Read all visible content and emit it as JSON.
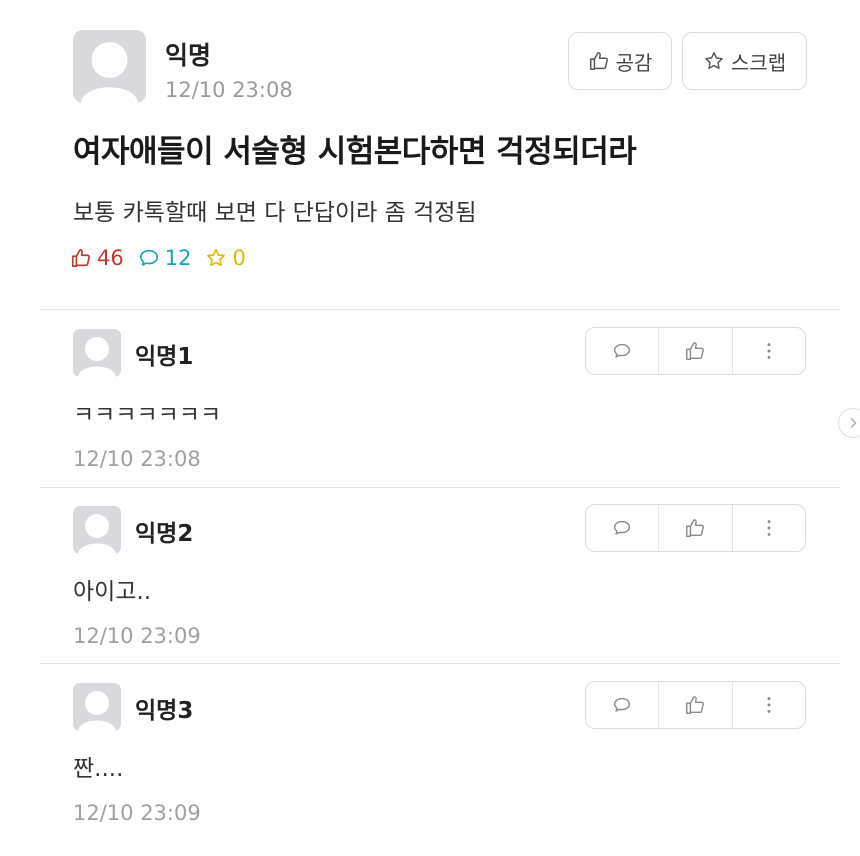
{
  "post": {
    "author": "익명",
    "time": "12/10 23:08",
    "title": "여자애들이 서술형 시험본다하면 걱정되더라",
    "body": "보통 카톡할때 보면 다 단답이라 좀 걱정됨",
    "buttons": {
      "like_label": "공감",
      "scrap_label": "스크랩"
    },
    "stats": {
      "likes": "46",
      "comments": "12",
      "scraps": "0"
    }
  },
  "comments": [
    {
      "author": "익명1",
      "text": "ㅋㅋㅋㅋㅋㅋㅋ",
      "time": "12/10 23:08"
    },
    {
      "author": "익명2",
      "text": "아이고..",
      "time": "12/10 23:09"
    },
    {
      "author": "익명3",
      "text": "짠....",
      "time": "12/10 23:09"
    }
  ],
  "colors": {
    "like": "#c0392b",
    "comment": "#1aa3b8",
    "scrap": "#e1b800"
  },
  "icons": [
    "avatar-icon",
    "thumbs-up-icon",
    "star-icon",
    "speech-bubble-icon",
    "more-vertical-icon",
    "chevron-right-icon"
  ]
}
